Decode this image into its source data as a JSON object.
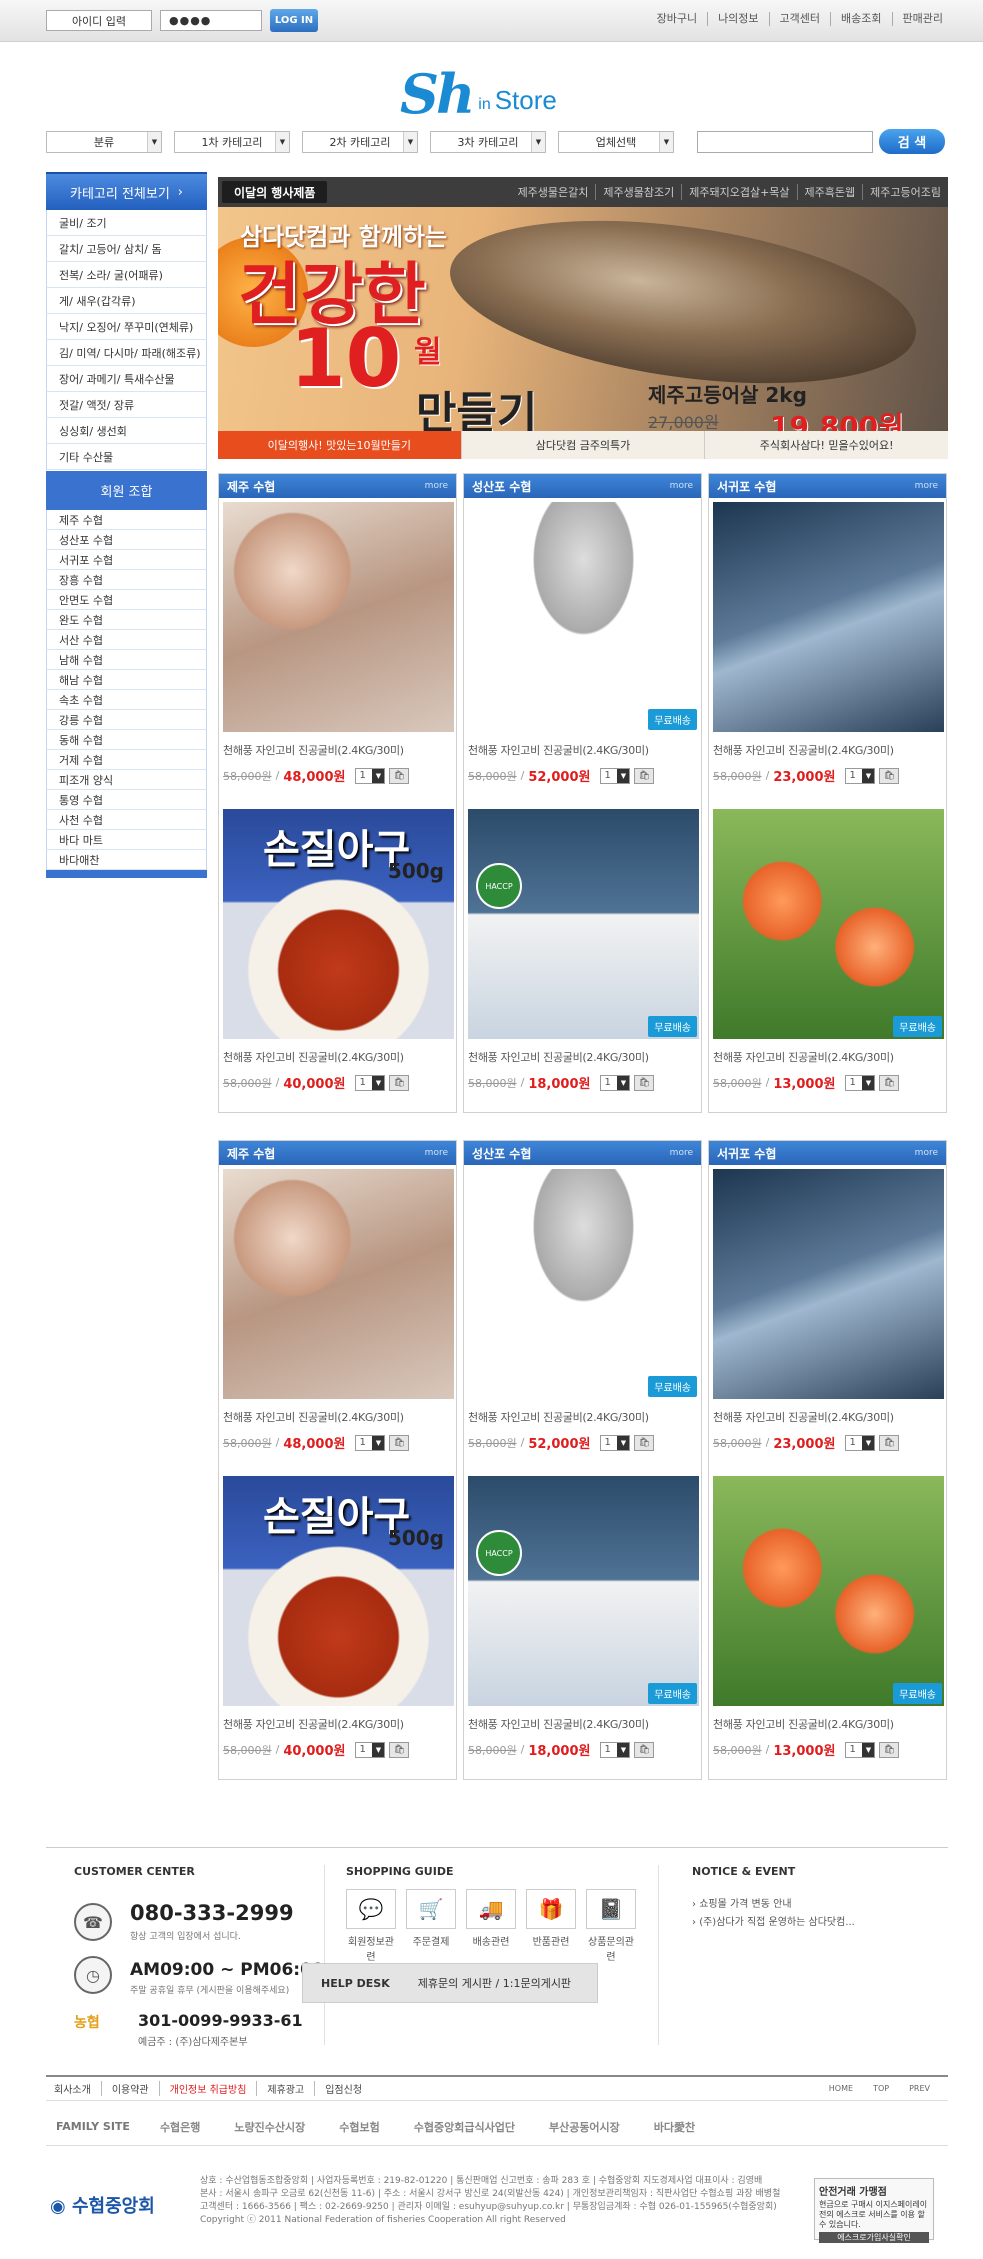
{
  "topbar": {
    "login_id_label": "아이디 입력",
    "login_pw_value": "●●●●",
    "login_button": "LOG IN",
    "links": [
      "장바구니",
      "나의정보",
      "고객센터",
      "배송조회",
      "판매관리"
    ]
  },
  "logo": {
    "sh": "Sh",
    "in": "in",
    "store": "Store"
  },
  "search": {
    "selects": [
      "분류",
      "1차 카테고리",
      "2차 카테고리",
      "3차 카테고리",
      "업체선택"
    ],
    "input_value": "",
    "button": "검 색"
  },
  "sidebar": {
    "header": "카테고리 전체보기",
    "items": [
      "굴비/ 조기",
      "갈치/ 고등어/ 삼치/ 돔",
      "전복/ 소라/ 굴(어패류)",
      "게/ 새우(갑각류)",
      "낙지/ 오징어/ 쭈꾸미(연체류)",
      "김/ 미역/ 다시마/ 파래(해조류)",
      "장어/ 과메기/ 특새수산물",
      "젓갈/ 액젓/ 장류",
      "싱싱회/ 생선회",
      "기타 수산물"
    ],
    "member_header": "회원 조합",
    "members": [
      "제주 수협",
      "성산포 수협",
      "서귀포 수협",
      "장흥 수협",
      "안면도 수협",
      "완도 수협",
      "서산 수협",
      "남해 수협",
      "해남 수협",
      "속초 수협",
      "강릉 수협",
      "동해 수협",
      "거제 수협",
      "피조개 양식",
      "통영 수협",
      "사천 수협",
      "바다 마트",
      "바다애찬"
    ]
  },
  "banner": {
    "event_tab": "이달의 행사제품",
    "links": [
      "제주생물은갈치",
      "제주생물참조기",
      "제주돼지오겹살+목살",
      "제주흑돈웹",
      "제주고등어조림"
    ],
    "sub": "삼다닷컴과 함께하는",
    "big": "건강한",
    "num": "10",
    "month": "월",
    "make": "만들기",
    "product": "제주고등어살 2kg",
    "old_price": "27,000원",
    "price": "19,800원",
    "bottom_tabs": [
      "이달의행사! 맛있는10월만들기",
      "삼다닷컴 금주의특가",
      "주식회사삼다! 믿을수있어요!"
    ]
  },
  "grid1": [
    {
      "head": "제주 수협",
      "more": "more",
      "items": [
        {
          "img": "shrimp",
          "name": "천해풍 자인고비 진공굴비(2.4KG/30미)",
          "old": "58,000원",
          "price": "48,000원",
          "qty": "1",
          "free": ""
        },
        {
          "img": "pasta",
          "name": "천해풍 자인고비 진공굴비(2.4KG/30미)",
          "old": "58,000원",
          "price": "40,000원",
          "qty": "1",
          "free": "",
          "overlay1": "손질아구",
          "overlay2": "500g"
        }
      ]
    },
    {
      "head": "성산포 수협",
      "more": "more",
      "items": [
        {
          "img": "anchovy",
          "name": "천해풍 자인고비 진공굴비(2.4KG/30미)",
          "old": "58,000원",
          "price": "52,000원",
          "qty": "1",
          "free": "무료배송"
        },
        {
          "img": "mack2",
          "name": "천해풍 자인고비 진공굴비(2.4KG/30미)",
          "old": "58,000원",
          "price": "18,000원",
          "qty": "1",
          "free": "무료배송",
          "haccp": "HACCP"
        }
      ]
    },
    {
      "head": "서귀포 수협",
      "more": "more",
      "items": [
        {
          "img": "mackerel",
          "name": "천해풍 자인고비 진공굴비(2.4KG/30미)",
          "old": "58,000원",
          "price": "23,000원",
          "qty": "1",
          "free": ""
        },
        {
          "img": "shrimp2",
          "name": "천해풍 자인고비 진공굴비(2.4KG/30미)",
          "old": "58,000원",
          "price": "13,000원",
          "qty": "1",
          "free": "무료배송"
        }
      ]
    }
  ],
  "footer": {
    "cs_title": "CUSTOMER CENTER",
    "phone": "080-333-2999",
    "phone_sub": "항상 고객의 입장에서 섭니다.",
    "hours": "AM09:00 ~ PM06:00",
    "hours_sub": "주말 공휴일 휴무 (게시판을 이용해주세요)",
    "bank_name": "농협",
    "account": "301-0099-9933-61",
    "holder": "예금주 : (주)삼다제주본부",
    "sg_title": "SHOPPING GUIDE",
    "sg_items": [
      "회원정보관련",
      "주문결제",
      "배송관련",
      "반품관련",
      "상품문의관련"
    ],
    "helpdesk": "HELP DESK",
    "helpdesk_links": "제휴문의 게시판 / 1:1문의게시판",
    "notice_title": "NOTICE & EVENT",
    "notices": [
      "쇼핑몰 가격 변동 안내",
      "(주)삼다가 직접 운영하는 삼다닷컴..."
    ],
    "nav": [
      "회사소개",
      "이용약관",
      "개인정보 취급방침",
      "제휴광고",
      "입점신청"
    ],
    "nav_right": [
      "HOME",
      "TOP",
      "PREV"
    ],
    "family_label": "FAMILY SITE",
    "family": [
      "수협은행",
      "노량진수산시장",
      "수협보험",
      "수협중앙회급식사업단",
      "부산공동어시장",
      "바다愛찬"
    ],
    "copy_lines": [
      "상호 : 수산업협동조합중앙회 | 사업자등록번호 : 219-82-01220 | 통신판매업 신고번호 : 송파 283 호 | 수협중앙회 지도경제사업 대표이사 : 김영배",
      "본사 : 서울시 송파구 오금로 62(신천동 11-6) | 주소 : 서울시 강서구 방신로 24(외발산동 424) | 개인정보관리책임자 : 직판사업단 수협쇼핑 과장 배병철",
      "고객센터 : 1666-3566 | 팩스 : 02-2669-9250 | 관리자 이메일 : esuhyup@suhyup.co.kr | 무통장입금계좌 : 수협 026-01-155965(수협중앙회)",
      "Copyright ⓒ 2011  National Federation of fisheries Cooperation All right Reserved"
    ],
    "footer_logo": "수협중앙회",
    "safe_title": "안전거래 가맹점",
    "safe_text": "현금으로 구매시 이지스페이레이전의 에스크로 서비스를 이용 할 수 있습니다.",
    "safe_link": "에스크로가입사실확인"
  }
}
